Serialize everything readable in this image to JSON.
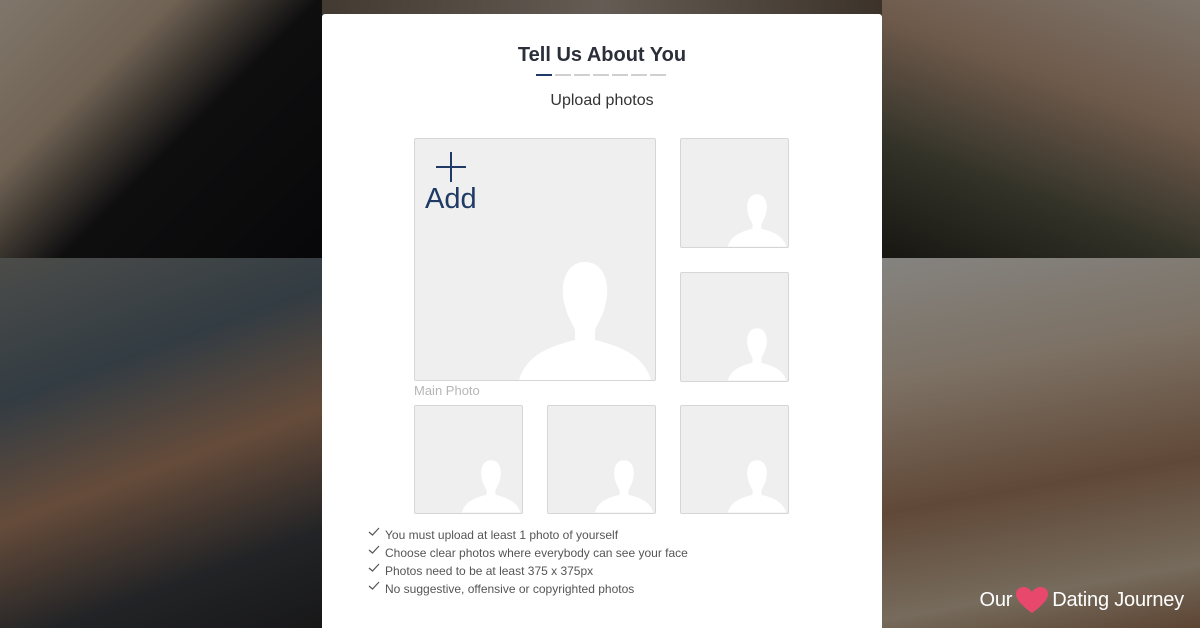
{
  "card": {
    "title": "Tell Us About You",
    "subtitle": "Upload photos",
    "progress": {
      "total_steps": 7,
      "current_step": 1
    }
  },
  "photo_slots": {
    "main": {
      "add_label": "Add",
      "caption": "Main Photo"
    }
  },
  "requirements": [
    "You must upload at least 1 photo of yourself",
    "Choose clear photos where everybody can see your face",
    "Photos need to be at least 375 x 375px",
    "No suggestive, offensive or copyrighted photos"
  ],
  "watermark": {
    "left_text": "Our",
    "right_text": "Dating Journey",
    "heart_color": "#e8486c"
  },
  "colors": {
    "accent": "#1f3a64",
    "placeholder_bg": "#efefef",
    "silhouette": "#ffffff"
  },
  "icons": {
    "plus": "plus-icon",
    "silhouette": "person-silhouette-icon",
    "check": "check-icon",
    "heart": "heart-icon"
  }
}
